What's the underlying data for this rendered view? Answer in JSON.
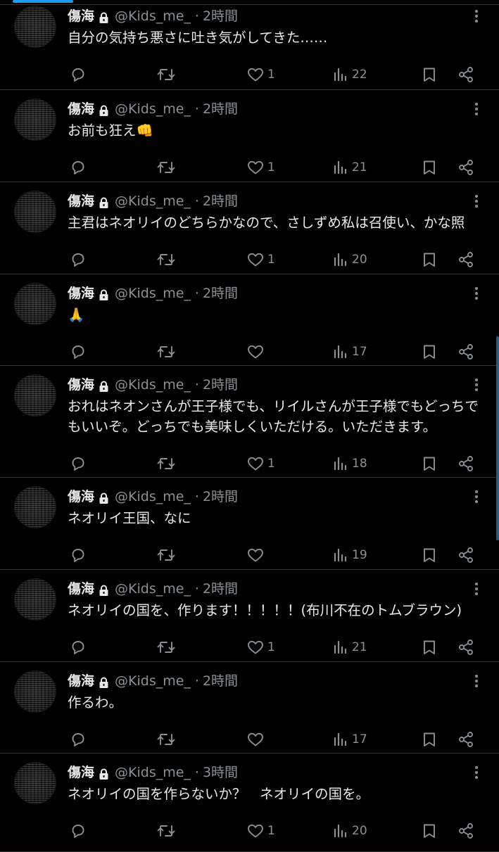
{
  "colors": {
    "background": "#000000",
    "text": "#e7e9ea",
    "muted": "#8b9095",
    "divider": "#2f3336",
    "accent": "#1d9bf0"
  },
  "icons": {
    "reply": "reply-icon",
    "retweet": "retweet-icon",
    "like": "heart-icon",
    "views": "views-icon",
    "bookmark": "bookmark-icon",
    "share": "share-icon",
    "more": "more-icon",
    "protected": "lock-icon"
  },
  "tweets": [
    {
      "name": "傷海",
      "handle": "@Kids_me_",
      "dot": "·",
      "time": "2時間",
      "text": "自分の気持ち悪さに吐き気がしてきた……",
      "likes": "1",
      "views": "22"
    },
    {
      "name": "傷海",
      "handle": "@Kids_me_",
      "dot": "·",
      "time": "2時間",
      "text": "お前も狂え👊",
      "likes": "1",
      "views": "21"
    },
    {
      "name": "傷海",
      "handle": "@Kids_me_",
      "dot": "·",
      "time": "2時間",
      "text": "主君はネオリイのどちらかなので、さしずめ私は召使い、かな照",
      "likes": "1",
      "views": "20"
    },
    {
      "name": "傷海",
      "handle": "@Kids_me_",
      "dot": "·",
      "time": "2時間",
      "text": "🙏",
      "likes": "",
      "views": "17"
    },
    {
      "name": "傷海",
      "handle": "@Kids_me_",
      "dot": "·",
      "time": "2時間",
      "text": "おれはネオンさんが王子様でも、リイルさんが王子様でもどっちでもいいぞ。どっちでも美味しくいただける。いただきます。",
      "likes": "1",
      "views": "18"
    },
    {
      "name": "傷海",
      "handle": "@Kids_me_",
      "dot": "·",
      "time": "2時間",
      "text": "ネオリイ王国、なに",
      "likes": "",
      "views": "19"
    },
    {
      "name": "傷海",
      "handle": "@Kids_me_",
      "dot": "·",
      "time": "2時間",
      "text": "ネオリイの国を、作ります！！！！！(布川不在のトムブラウン)",
      "likes": "1",
      "views": "21"
    },
    {
      "name": "傷海",
      "handle": "@Kids_me_",
      "dot": "·",
      "time": "2時間",
      "text": "作るわ。",
      "likes": "",
      "views": "17"
    },
    {
      "name": "傷海",
      "handle": "@Kids_me_",
      "dot": "·",
      "time": "3時間",
      "text": "ネオリイの国を作らないか？　ネオリイの国を。",
      "likes": "1",
      "views": "20"
    }
  ]
}
